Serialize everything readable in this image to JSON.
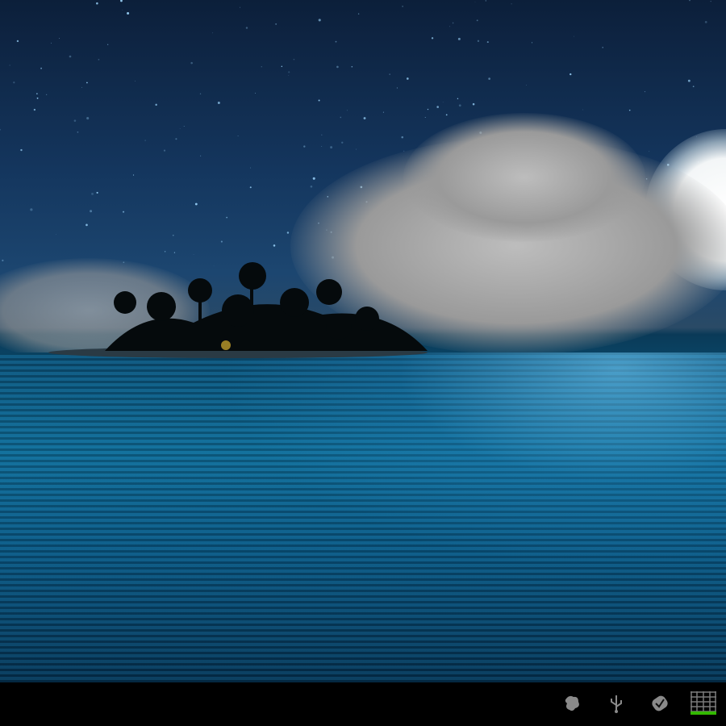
{
  "wallpaper": {
    "description_icon": "night-island-wallpaper"
  },
  "status_bar": {
    "icons": [
      "debug-icon",
      "usb-icon",
      "notification-check-icon",
      "apps-grid-icon"
    ]
  },
  "colors": {
    "bar": "#000000",
    "accent": "#33b800",
    "icon": "#9a9a9a"
  }
}
